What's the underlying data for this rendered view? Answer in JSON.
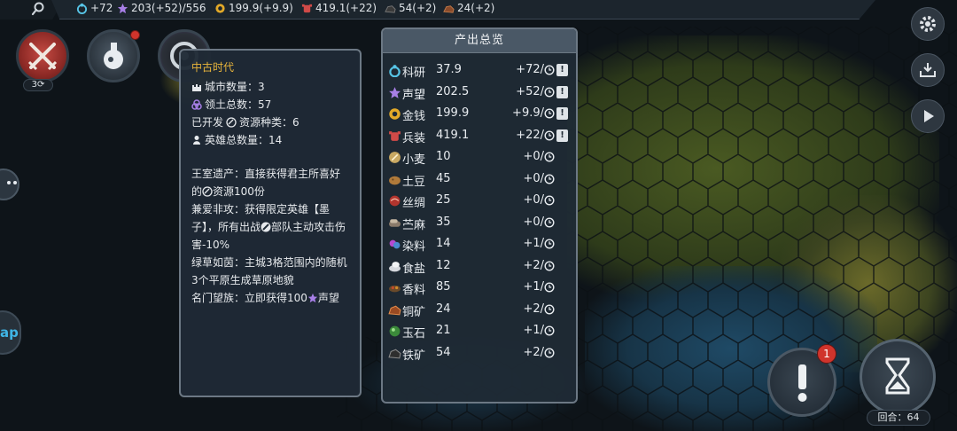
{
  "topbar": {
    "research": "+72",
    "fame": "203(+52)/556",
    "gold": "199.9(+9.9)",
    "arms": "419.1(+22)",
    "item5": "54(+2)",
    "item6": "24(+2)"
  },
  "war_badge": "3",
  "era": {
    "title": "中古时代",
    "cities": "城市数量：3",
    "territory": "领土总数：57",
    "resource_types_pre": "已开发",
    "resource_types_post": "资源种类：6",
    "heroes": "英雄总数量：14",
    "p1a": "王室遗产：直接获得君主所喜好的",
    "p1b": "资源100份",
    "p2a": "兼爱非攻：获得限定英雄【墨子】，所有出战",
    "p2b": "部队主动攻击伤害-10%",
    "p3": "绿草如茵：主城3格范围内的随机3个平原生成草原地貌",
    "p4a": "名门望族：立即获得100",
    "p4b": "声望"
  },
  "output": {
    "title": "产出总览",
    "rows": [
      {
        "name": "科研",
        "value": "37.9",
        "delta": "+72/",
        "icon": "research-icon",
        "warn": true
      },
      {
        "name": "声望",
        "value": "202.5",
        "delta": "+52/",
        "icon": "fame-star-icon",
        "warn": true
      },
      {
        "name": "金钱",
        "value": "199.9",
        "delta": "+9.9/",
        "icon": "gold-coin-icon",
        "warn": true
      },
      {
        "name": "兵装",
        "value": "419.1",
        "delta": "+22/",
        "icon": "arms-icon",
        "warn": true
      },
      {
        "name": "小麦",
        "value": "10",
        "delta": "+0/",
        "icon": "wheat-icon",
        "warn": false
      },
      {
        "name": "土豆",
        "value": "45",
        "delta": "+0/",
        "icon": "potato-icon",
        "warn": false
      },
      {
        "name": "丝绸",
        "value": "25",
        "delta": "+0/",
        "icon": "silk-icon",
        "warn": false
      },
      {
        "name": "苎麻",
        "value": "35",
        "delta": "+0/",
        "icon": "ramie-icon",
        "warn": false
      },
      {
        "name": "染料",
        "value": "14",
        "delta": "+1/",
        "icon": "dye-icon",
        "warn": false
      },
      {
        "name": "食盐",
        "value": "12",
        "delta": "+2/",
        "icon": "salt-icon",
        "warn": false
      },
      {
        "name": "香料",
        "value": "85",
        "delta": "+1/",
        "icon": "spice-icon",
        "warn": false
      },
      {
        "name": "铜矿",
        "value": "24",
        "delta": "+2/",
        "icon": "copper-icon",
        "warn": false
      },
      {
        "name": "玉石",
        "value": "21",
        "delta": "+1/",
        "icon": "jade-icon",
        "warn": false
      },
      {
        "name": "铁矿",
        "value": "54",
        "delta": "+2/",
        "icon": "iron-icon",
        "warn": false
      }
    ]
  },
  "alert_badge": "1",
  "round": "回合：64",
  "map_button": "ap",
  "colors": {
    "accent_gold": "#e9b53b",
    "panel_bg": "#1f2a35",
    "panel_border": "#6c7884",
    "alert_red": "#d0342c"
  }
}
